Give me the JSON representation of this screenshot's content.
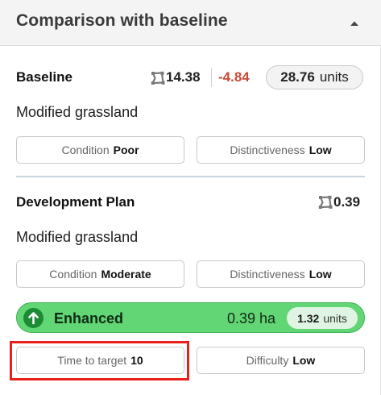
{
  "header": {
    "title": "Comparison with baseline"
  },
  "baseline": {
    "title": "Baseline",
    "area": "14.38",
    "delta": "-4.84",
    "units_value": "28.76",
    "units_label": "units",
    "habitat": "Modified grassland",
    "condition_label": "Condition",
    "condition_value": "Poor",
    "distinctiveness_label": "Distinctiveness",
    "distinctiveness_value": "Low"
  },
  "plan": {
    "title": "Development Plan",
    "area": "0.39",
    "habitat": "Modified grassland",
    "condition_label": "Condition",
    "condition_value": "Moderate",
    "distinctiveness_label": "Distinctiveness",
    "distinctiveness_value": "Low",
    "intervention": {
      "label": "Enhanced",
      "area": "0.39 ha",
      "units_value": "1.32",
      "units_label": "units"
    },
    "time_label": "Time to target",
    "time_value": "10",
    "difficulty_label": "Difficulty",
    "difficulty_value": "Low"
  },
  "colors": {
    "delta_negative": "#c94a3a",
    "enhanced_green": "#62d575",
    "highlight_red": "#e8201c"
  },
  "icons": {
    "collapse": "caret-up-icon",
    "area": "area-polygon-icon",
    "enhanced": "arrow-up-circle-icon"
  }
}
